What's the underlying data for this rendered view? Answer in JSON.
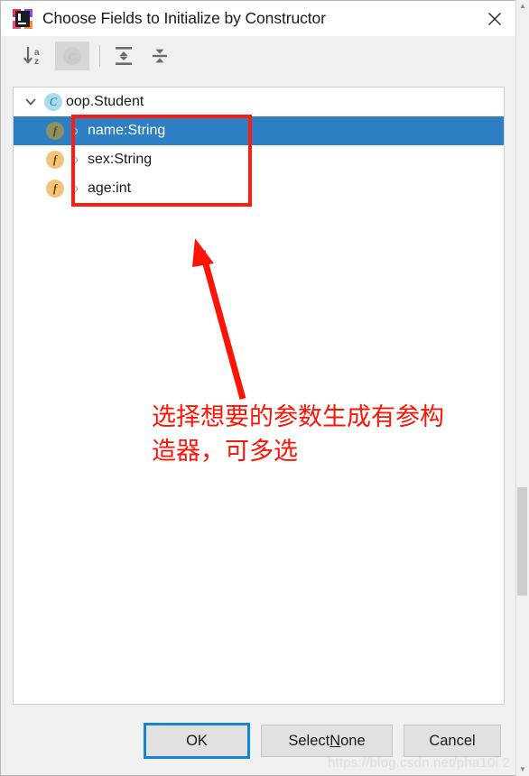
{
  "window": {
    "title": "Choose Fields to Initialize by Constructor",
    "app_icon": "intellij-idea-icon",
    "close_icon": "close-icon"
  },
  "toolbar": {
    "buttons": [
      {
        "name": "sort-alphabetically",
        "icon": "sort-alpha-down-icon",
        "label": "",
        "enabled": true
      },
      {
        "name": "show-class-name",
        "icon": "class-c-icon",
        "label": "C",
        "enabled": false
      },
      {
        "name": "expand-all",
        "icon": "expand-all-icon",
        "label": "",
        "enabled": true
      },
      {
        "name": "collapse-all",
        "icon": "collapse-all-icon",
        "label": "",
        "enabled": true
      }
    ]
  },
  "tree": {
    "root": {
      "label": "oop.Student",
      "badge": "C",
      "badge_icon": "class-badge-icon",
      "twisty": "chevron-down-icon",
      "expanded": true
    },
    "fields": [
      {
        "label": "name:String",
        "badge": "f",
        "badge_icon": "field-badge-icon",
        "visibility_icon": "private-dot-icon",
        "selected": true
      },
      {
        "label": "sex:String",
        "badge": "f",
        "badge_icon": "field-badge-icon",
        "visibility_icon": "private-dot-icon",
        "selected": false
      },
      {
        "label": "age:int",
        "badge": "f",
        "badge_icon": "field-badge-icon",
        "visibility_icon": "private-dot-icon",
        "selected": false
      }
    ]
  },
  "annotations": {
    "box_color": "#fc1c10",
    "arrow_color": "#fd1405",
    "text_color": "#fd1405",
    "text": "选择想要的参数生成有参构\n造器，可多选"
  },
  "buttons": {
    "ok": "OK",
    "select_none_before": "Select ",
    "select_none_mnemonic": "N",
    "select_none_after": "one",
    "cancel": "Cancel"
  },
  "watermark": {
    "text": "https://blog.csdn.net/pha10i 2"
  },
  "colors": {
    "selection_blue": "#2c7fc3",
    "focus_blue": "#1484d6",
    "field_badge": "#f5c377",
    "class_badge": "#aadcf0",
    "dialog_bg": "#f0f0f0"
  }
}
